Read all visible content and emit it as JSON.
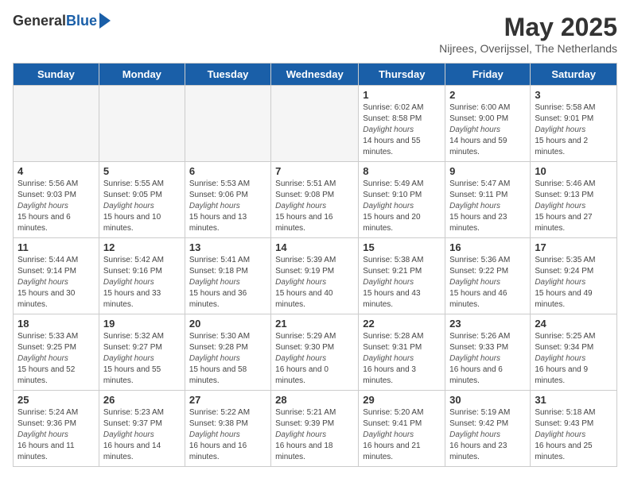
{
  "header": {
    "logo_general": "General",
    "logo_blue": "Blue",
    "month_title": "May 2025",
    "location": "Nijrees, Overijssel, The Netherlands"
  },
  "columns": [
    "Sunday",
    "Monday",
    "Tuesday",
    "Wednesday",
    "Thursday",
    "Friday",
    "Saturday"
  ],
  "weeks": [
    [
      {
        "day": "",
        "sunrise": "",
        "sunset": "",
        "daylight": "",
        "empty": true
      },
      {
        "day": "",
        "sunrise": "",
        "sunset": "",
        "daylight": "",
        "empty": true
      },
      {
        "day": "",
        "sunrise": "",
        "sunset": "",
        "daylight": "",
        "empty": true
      },
      {
        "day": "",
        "sunrise": "",
        "sunset": "",
        "daylight": "",
        "empty": true
      },
      {
        "day": "1",
        "sunrise": "6:02 AM",
        "sunset": "8:58 PM",
        "daylight": "14 hours and 55 minutes.",
        "empty": false
      },
      {
        "day": "2",
        "sunrise": "6:00 AM",
        "sunset": "9:00 PM",
        "daylight": "14 hours and 59 minutes.",
        "empty": false
      },
      {
        "day": "3",
        "sunrise": "5:58 AM",
        "sunset": "9:01 PM",
        "daylight": "15 hours and 2 minutes.",
        "empty": false
      }
    ],
    [
      {
        "day": "4",
        "sunrise": "5:56 AM",
        "sunset": "9:03 PM",
        "daylight": "15 hours and 6 minutes.",
        "empty": false
      },
      {
        "day": "5",
        "sunrise": "5:55 AM",
        "sunset": "9:05 PM",
        "daylight": "15 hours and 10 minutes.",
        "empty": false
      },
      {
        "day": "6",
        "sunrise": "5:53 AM",
        "sunset": "9:06 PM",
        "daylight": "15 hours and 13 minutes.",
        "empty": false
      },
      {
        "day": "7",
        "sunrise": "5:51 AM",
        "sunset": "9:08 PM",
        "daylight": "15 hours and 16 minutes.",
        "empty": false
      },
      {
        "day": "8",
        "sunrise": "5:49 AM",
        "sunset": "9:10 PM",
        "daylight": "15 hours and 20 minutes.",
        "empty": false
      },
      {
        "day": "9",
        "sunrise": "5:47 AM",
        "sunset": "9:11 PM",
        "daylight": "15 hours and 23 minutes.",
        "empty": false
      },
      {
        "day": "10",
        "sunrise": "5:46 AM",
        "sunset": "9:13 PM",
        "daylight": "15 hours and 27 minutes.",
        "empty": false
      }
    ],
    [
      {
        "day": "11",
        "sunrise": "5:44 AM",
        "sunset": "9:14 PM",
        "daylight": "15 hours and 30 minutes.",
        "empty": false
      },
      {
        "day": "12",
        "sunrise": "5:42 AM",
        "sunset": "9:16 PM",
        "daylight": "15 hours and 33 minutes.",
        "empty": false
      },
      {
        "day": "13",
        "sunrise": "5:41 AM",
        "sunset": "9:18 PM",
        "daylight": "15 hours and 36 minutes.",
        "empty": false
      },
      {
        "day": "14",
        "sunrise": "5:39 AM",
        "sunset": "9:19 PM",
        "daylight": "15 hours and 40 minutes.",
        "empty": false
      },
      {
        "day": "15",
        "sunrise": "5:38 AM",
        "sunset": "9:21 PM",
        "daylight": "15 hours and 43 minutes.",
        "empty": false
      },
      {
        "day": "16",
        "sunrise": "5:36 AM",
        "sunset": "9:22 PM",
        "daylight": "15 hours and 46 minutes.",
        "empty": false
      },
      {
        "day": "17",
        "sunrise": "5:35 AM",
        "sunset": "9:24 PM",
        "daylight": "15 hours and 49 minutes.",
        "empty": false
      }
    ],
    [
      {
        "day": "18",
        "sunrise": "5:33 AM",
        "sunset": "9:25 PM",
        "daylight": "15 hours and 52 minutes.",
        "empty": false
      },
      {
        "day": "19",
        "sunrise": "5:32 AM",
        "sunset": "9:27 PM",
        "daylight": "15 hours and 55 minutes.",
        "empty": false
      },
      {
        "day": "20",
        "sunrise": "5:30 AM",
        "sunset": "9:28 PM",
        "daylight": "15 hours and 58 minutes.",
        "empty": false
      },
      {
        "day": "21",
        "sunrise": "5:29 AM",
        "sunset": "9:30 PM",
        "daylight": "16 hours and 0 minutes.",
        "empty": false
      },
      {
        "day": "22",
        "sunrise": "5:28 AM",
        "sunset": "9:31 PM",
        "daylight": "16 hours and 3 minutes.",
        "empty": false
      },
      {
        "day": "23",
        "sunrise": "5:26 AM",
        "sunset": "9:33 PM",
        "daylight": "16 hours and 6 minutes.",
        "empty": false
      },
      {
        "day": "24",
        "sunrise": "5:25 AM",
        "sunset": "9:34 PM",
        "daylight": "16 hours and 9 minutes.",
        "empty": false
      }
    ],
    [
      {
        "day": "25",
        "sunrise": "5:24 AM",
        "sunset": "9:36 PM",
        "daylight": "16 hours and 11 minutes.",
        "empty": false
      },
      {
        "day": "26",
        "sunrise": "5:23 AM",
        "sunset": "9:37 PM",
        "daylight": "16 hours and 14 minutes.",
        "empty": false
      },
      {
        "day": "27",
        "sunrise": "5:22 AM",
        "sunset": "9:38 PM",
        "daylight": "16 hours and 16 minutes.",
        "empty": false
      },
      {
        "day": "28",
        "sunrise": "5:21 AM",
        "sunset": "9:39 PM",
        "daylight": "16 hours and 18 minutes.",
        "empty": false
      },
      {
        "day": "29",
        "sunrise": "5:20 AM",
        "sunset": "9:41 PM",
        "daylight": "16 hours and 21 minutes.",
        "empty": false
      },
      {
        "day": "30",
        "sunrise": "5:19 AM",
        "sunset": "9:42 PM",
        "daylight": "16 hours and 23 minutes.",
        "empty": false
      },
      {
        "day": "31",
        "sunrise": "5:18 AM",
        "sunset": "9:43 PM",
        "daylight": "16 hours and 25 minutes.",
        "empty": false
      }
    ]
  ],
  "labels": {
    "sunrise": "Sunrise:",
    "sunset": "Sunset:",
    "daylight": "Daylight hours"
  }
}
